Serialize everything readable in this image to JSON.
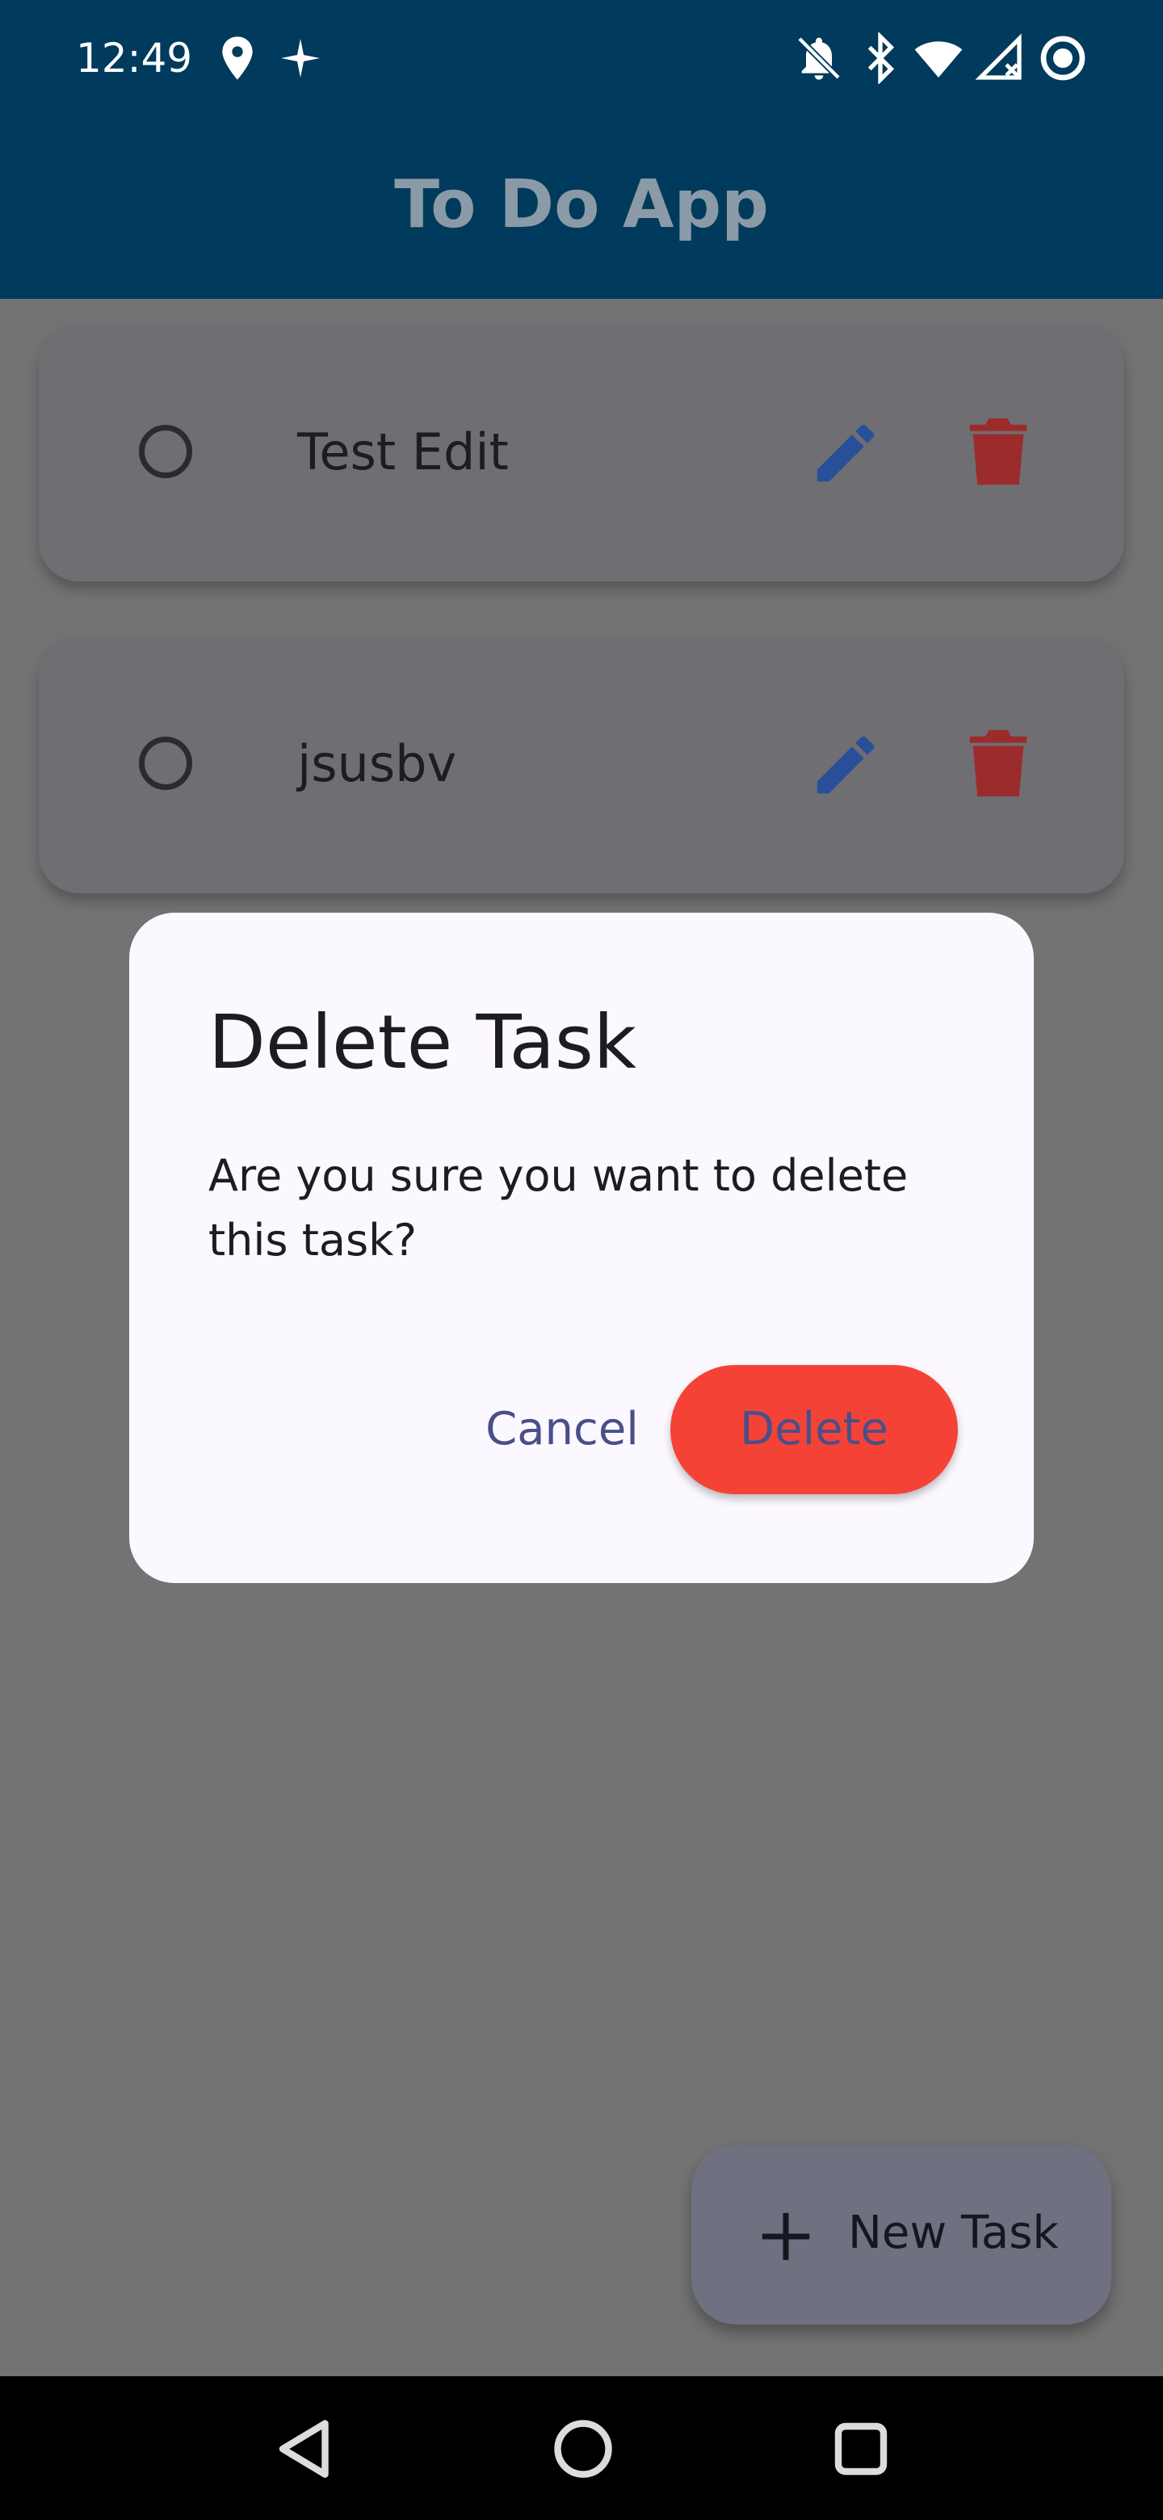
{
  "status_bar": {
    "time": "12:49",
    "left_icons": [
      "location-pin-icon",
      "sparkle-icon"
    ],
    "right_icons": [
      "notifications-off-icon",
      "bluetooth-icon",
      "wifi-icon",
      "signal-icon",
      "battery-ring-icon"
    ]
  },
  "app_bar": {
    "title": "To Do App"
  },
  "tasks": [
    {
      "title": "Test Edit",
      "completed": false
    },
    {
      "title": "jsusbv",
      "completed": false
    }
  ],
  "dialog": {
    "title": "Delete Task",
    "message": "Are you sure you want to delete this task?",
    "cancel_label": "Cancel",
    "delete_label": "Delete"
  },
  "fab": {
    "label": "New Task",
    "icon": "plus-icon"
  },
  "nav_bar": {
    "buttons": [
      "back-icon",
      "home-icon",
      "recents-icon"
    ]
  },
  "colors": {
    "app_bar": "#003a5c",
    "scrim_background": "#737373",
    "edit_icon": "#2a4f99",
    "delete_icon": "#9c2c2c",
    "delete_button": "#f44336",
    "dialog_background": "#fcf8ff"
  }
}
